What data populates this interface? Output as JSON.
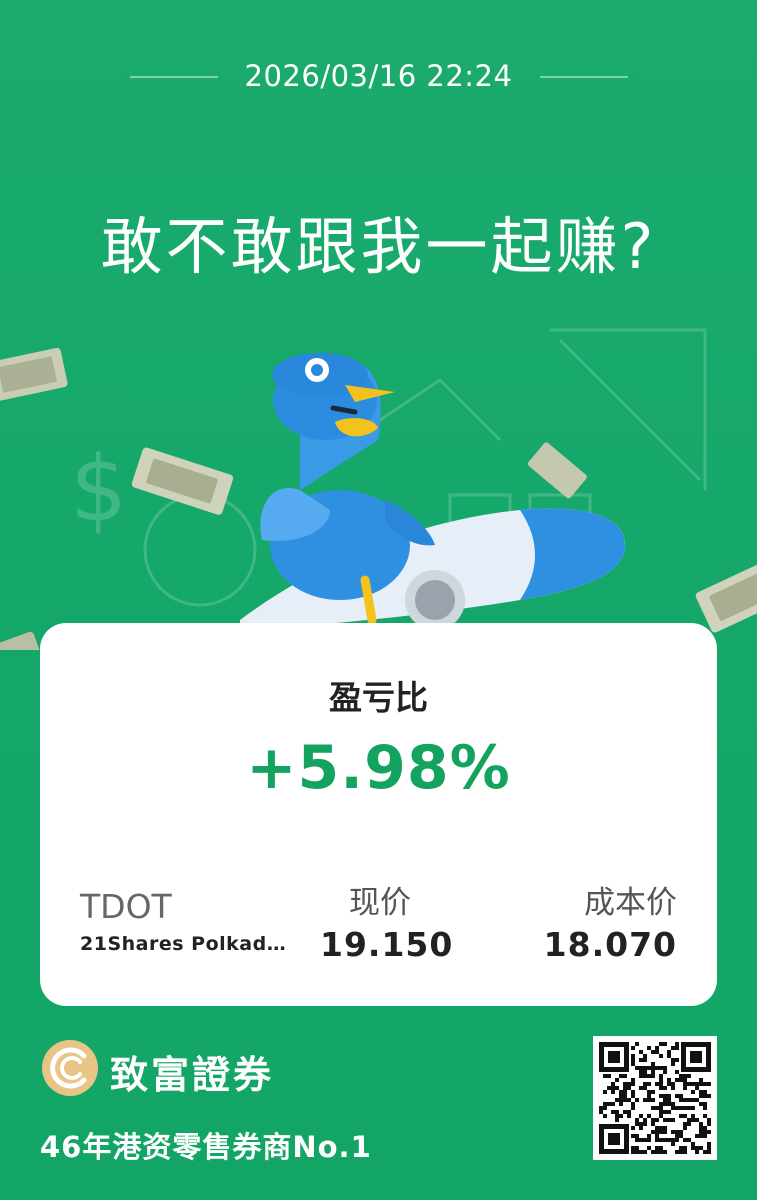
{
  "header": {
    "datetime": "2026/03/16 22:24",
    "headline": "敢不敢跟我一起赚?"
  },
  "card": {
    "title": "盈亏比",
    "pnl_ratio": "+5.98%",
    "ticker": "TDOT",
    "security_name": "21Shares Polkad…",
    "current_price_label": "现价",
    "current_price": "19.150",
    "cost_price_label": "成本价",
    "cost_price": "18.070"
  },
  "footer": {
    "brand_name": "致富證券",
    "slogan": "46年港资零售券商No.1"
  },
  "colors": {
    "background": "#16a86b",
    "accent_green": "#14a35f",
    "bird_blue": "#2f8fe0",
    "brand_gold": "#e8c487"
  },
  "icons": {
    "mascot": "blue-bird-mascot",
    "rocket": "rocket-icon",
    "logo": "company-logo-icon",
    "qr": "qr-code"
  }
}
